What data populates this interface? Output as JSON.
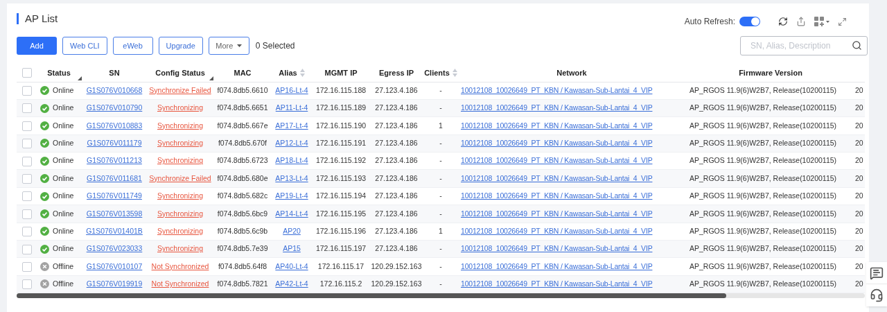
{
  "title": "AP List",
  "auto_refresh": {
    "label": "Auto Refresh:",
    "on": true
  },
  "toolbar": {
    "buttons": [
      {
        "label": "Add",
        "kind": "primary"
      },
      {
        "label": "Web CLI",
        "kind": "outline"
      },
      {
        "label": "eWeb",
        "kind": "outline"
      },
      {
        "label": "Upgrade",
        "kind": "outline"
      },
      {
        "label": "More",
        "kind": "dropdown"
      }
    ],
    "selected_count": "0 Selected"
  },
  "search": {
    "placeholder": "SN, Alias, Description"
  },
  "table": {
    "header_checkbox": {
      "checked": false
    },
    "columns": [
      {
        "label": "Status",
        "filter": true,
        "sort": false
      },
      {
        "label": "SN",
        "filter": false,
        "sort": false
      },
      {
        "label": "Config Status",
        "filter": true,
        "sort": false
      },
      {
        "label": "MAC",
        "filter": false,
        "sort": false
      },
      {
        "label": "Alias",
        "filter": false,
        "sort": true
      },
      {
        "label": "MGMT IP",
        "filter": false,
        "sort": false
      },
      {
        "label": "Egress IP",
        "filter": false,
        "sort": false
      },
      {
        "label": "Clients",
        "filter": false,
        "sort": true
      },
      {
        "label": "Network",
        "filter": false,
        "sort": false
      },
      {
        "label": "Firmware Version",
        "filter": false,
        "sort": false
      }
    ],
    "rows": [
      {
        "selected": false,
        "kind": "online",
        "status": "Online",
        "sn": "G1S076V010668",
        "config_status": "Synchronize Failed",
        "mac": "f074.8db5.6610",
        "alias": "AP16-Lt-4",
        "mgmt_ip": "172.16.115.188",
        "egress_ip": "27.123.4.186",
        "clients": "-",
        "network": "10012108_10026649_PT_KBN / Kawasan-Sub-Lantai_4_VIP",
        "firmware": "AP_RGOS 11.9(6)W2B7, Release(10200115)",
        "column_12": "20"
      },
      {
        "selected": false,
        "kind": "online",
        "status": "Online",
        "sn": "G1S076V010790",
        "config_status": "Synchronizing",
        "mac": "f074.8db5.6651",
        "alias": "AP11-Lt-4",
        "mgmt_ip": "172.16.115.189",
        "egress_ip": "27.123.4.186",
        "clients": "-",
        "network": "10012108_10026649_PT_KBN / Kawasan-Sub-Lantai_4_VIP",
        "firmware": "AP_RGOS 11.9(6)W2B7, Release(10200115)",
        "column_12": "20"
      },
      {
        "selected": false,
        "kind": "online",
        "status": "Online",
        "sn": "G1S076V010883",
        "config_status": "Synchronizing",
        "mac": "f074.8db5.667e",
        "alias": "AP17-Lt-4",
        "mgmt_ip": "172.16.115.190",
        "egress_ip": "27.123.4.186",
        "clients": "1",
        "network": "10012108_10026649_PT_KBN / Kawasan-Sub-Lantai_4_VIP",
        "firmware": "AP_RGOS 11.9(6)W2B7, Release(10200115)",
        "column_12": "20"
      },
      {
        "selected": false,
        "kind": "online",
        "status": "Online",
        "sn": "G1S076V011179",
        "config_status": "Synchronizing",
        "mac": "f074.8db5.670f",
        "alias": "AP12-Lt-4",
        "mgmt_ip": "172.16.115.191",
        "egress_ip": "27.123.4.186",
        "clients": "-",
        "network": "10012108_10026649_PT_KBN / Kawasan-Sub-Lantai_4_VIP",
        "firmware": "AP_RGOS 11.9(6)W2B7, Release(10200115)",
        "column_12": "20"
      },
      {
        "selected": false,
        "kind": "online",
        "status": "Online",
        "sn": "G1S076V011213",
        "config_status": "Synchronizing",
        "mac": "f074.8db5.6723",
        "alias": "AP18-Lt-4",
        "mgmt_ip": "172.16.115.192",
        "egress_ip": "27.123.4.186",
        "clients": "-",
        "network": "10012108_10026649_PT_KBN / Kawasan-Sub-Lantai_4_VIP",
        "firmware": "AP_RGOS 11.9(6)W2B7, Release(10200115)",
        "column_12": "20"
      },
      {
        "selected": false,
        "kind": "online",
        "status": "Online",
        "sn": "G1S076V011681",
        "config_status": "Synchronize Failed",
        "mac": "f074.8db5.680e",
        "alias": "AP13-Lt-4",
        "mgmt_ip": "172.16.115.193",
        "egress_ip": "27.123.4.186",
        "clients": "-",
        "network": "10012108_10026649_PT_KBN / Kawasan-Sub-Lantai_4_VIP",
        "firmware": "AP_RGOS 11.9(6)W2B7, Release(10200115)",
        "column_12": "20"
      },
      {
        "selected": false,
        "kind": "online",
        "status": "Online",
        "sn": "G1S076V011749",
        "config_status": "Synchronizing",
        "mac": "f074.8db5.682c",
        "alias": "AP19-Lt-4",
        "mgmt_ip": "172.16.115.194",
        "egress_ip": "27.123.4.186",
        "clients": "-",
        "network": "10012108_10026649_PT_KBN / Kawasan-Sub-Lantai_4_VIP",
        "firmware": "AP_RGOS 11.9(6)W2B7, Release(10200115)",
        "column_12": "20"
      },
      {
        "selected": false,
        "kind": "online",
        "status": "Online",
        "sn": "G1S076V013598",
        "config_status": "Synchronizing",
        "mac": "f074.8db5.6bc9",
        "alias": "AP14-Lt-4",
        "mgmt_ip": "172.16.115.195",
        "egress_ip": "27.123.4.186",
        "clients": "-",
        "network": "10012108_10026649_PT_KBN / Kawasan-Sub-Lantai_4_VIP",
        "firmware": "AP_RGOS 11.9(6)W2B7, Release(10200115)",
        "column_12": "20"
      },
      {
        "selected": false,
        "kind": "online",
        "status": "Online",
        "sn": "G1S076V01401B",
        "config_status": "Synchronizing",
        "mac": "f074.8db5.6c9b",
        "alias": "AP20",
        "mgmt_ip": "172.16.115.196",
        "egress_ip": "27.123.4.186",
        "clients": "1",
        "network": "10012108_10026649_PT_KBN / Kawasan-Sub-Lantai_4_VIP",
        "firmware": "AP_RGOS 11.9(6)W2B7, Release(10200115)",
        "column_12": "20"
      },
      {
        "selected": false,
        "kind": "online",
        "status": "Online",
        "sn": "G1S076V023033",
        "config_status": "Synchronizing",
        "mac": "f074.8db5.7e39",
        "alias": "AP15",
        "mgmt_ip": "172.16.115.197",
        "egress_ip": "27.123.4.186",
        "clients": "-",
        "network": "10012108_10026649_PT_KBN / Kawasan-Sub-Lantai_4_VIP",
        "firmware": "AP_RGOS 11.9(6)W2B7, Release(10200115)",
        "column_12": "20"
      },
      {
        "selected": false,
        "kind": "offline",
        "status": "Offline",
        "sn": "G1S076V010107",
        "config_status": "Not Synchronized",
        "mac": "f074.8db5.64f8",
        "alias": "AP40-Lt-4",
        "mgmt_ip": "172.16.115.17",
        "egress_ip": "120.29.152.163",
        "clients": "-",
        "network": "10012108_10026649_PT_KBN / Kawasan-Sub-Lantai_4_VIP",
        "firmware": "AP_RGOS 11.9(6)W2B7, Release(10200115)",
        "column_12": "20"
      },
      {
        "selected": false,
        "kind": "offline",
        "status": "Offline",
        "sn": "G1S076V019919",
        "config_status": "Not Synchronized",
        "mac": "f074.8db5.7821",
        "alias": "AP42-Lt-4",
        "mgmt_ip": "172.16.115.2",
        "egress_ip": "120.29.152.163",
        "clients": "-",
        "network": "10012108_10026649_PT_KBN / Kawasan-Sub-Lantai_4_VIP",
        "firmware": "AP_RGOS 11.9(6)W2B7, Release(10200115)",
        "column_12": "20"
      }
    ]
  }
}
